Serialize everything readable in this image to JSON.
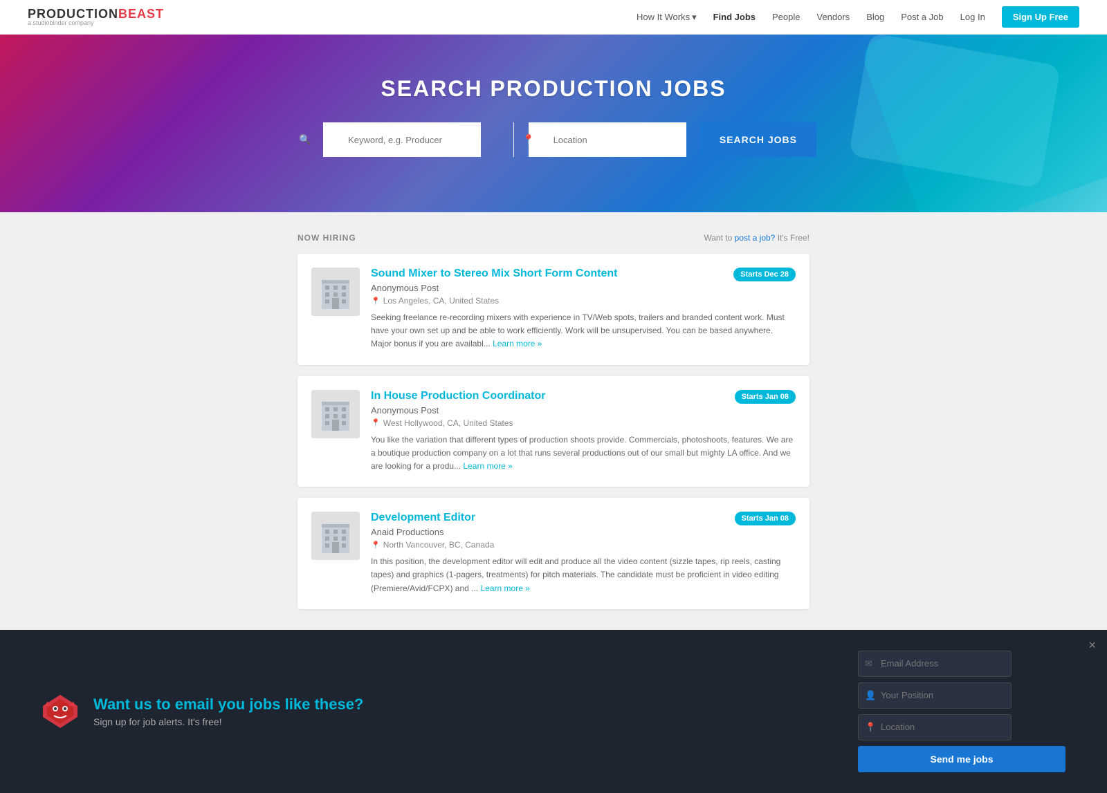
{
  "navbar": {
    "brand": {
      "production": "PRODUCTION",
      "beast": "BEAST",
      "tagline": "a studiobinder company"
    },
    "links": [
      {
        "label": "How It Works",
        "active": false,
        "hasDropdown": true
      },
      {
        "label": "Find Jobs",
        "active": true
      },
      {
        "label": "People",
        "active": false
      },
      {
        "label": "Vendors",
        "active": false
      },
      {
        "label": "Blog",
        "active": false
      },
      {
        "label": "Post a Job",
        "active": false
      },
      {
        "label": "Log In",
        "active": false
      }
    ],
    "signup_label": "Sign Up Free"
  },
  "hero": {
    "title": "SEARCH PRODUCTION JOBS",
    "keyword_placeholder": "Keyword, e.g. Producer",
    "location_placeholder": "Location",
    "search_btn": "SEARCH JOBS"
  },
  "jobs_section": {
    "now_hiring": "NOW HIRING",
    "post_job_text": "Want to",
    "post_job_link": "post a job?",
    "post_job_suffix": "It's Free!",
    "jobs": [
      {
        "title": "Sound Mixer to Stereo Mix Short Form Content",
        "company": "Anonymous Post",
        "location": "Los Angeles, CA, United States",
        "badge": "Starts Dec 28",
        "description": "Seeking freelance re-recording mixers with experience in TV/Web spots, trailers and branded content work. Must have your own set up and be able to work efficiently. Work will be unsupervised. You can be based anywhere. Major bonus if you are availabl...",
        "learn_more": "Learn more »"
      },
      {
        "title": "In House Production Coordinator",
        "company": "Anonymous Post",
        "location": "West Hollywood, CA, United States",
        "badge": "Starts Jan 08",
        "description": "You like the variation that different types of production shoots provide. Commercials, photoshoots, features. We are a boutique production company on a lot that runs several productions out of our small but mighty LA office. And we are looking for a produ...",
        "learn_more": "Learn more »"
      },
      {
        "title": "Development Editor",
        "company": "Anaid Productions",
        "location": "North Vancouver, BC, Canada",
        "badge": "Starts Jan 08",
        "description": "In this position, the development editor will edit and produce all the video content (sizzle tapes, rip reels, casting tapes) and graphics (1-pagers, treatments) for pitch materials. The candidate must be proficient in video editing (Premiere/Avid/FCPX) and ...",
        "learn_more": "Learn more »"
      }
    ]
  },
  "footer": {
    "headline": "Want us to email you jobs like these?",
    "subtext": "Sign up for job alerts. It's free!",
    "email_placeholder": "Email Address",
    "position_placeholder": "Your Position",
    "location_placeholder": "Location",
    "send_btn": "Send me jobs",
    "close": "×"
  }
}
